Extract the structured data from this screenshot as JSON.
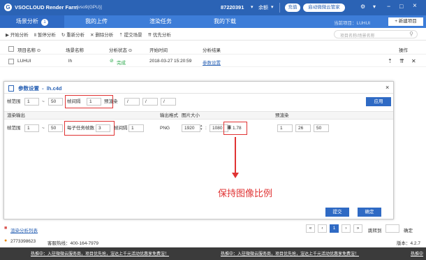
{
  "titlebar": {
    "app_title": "VSOCLOUD Render Farm",
    "version": "[vso9(GPU)]",
    "account_id": "87220391",
    "balance_label": "余额",
    "recharge_label": "充值",
    "activate_label": "启动微微云管家",
    "window_controls": [
      "⚙",
      "▾",
      "−",
      "□",
      "×"
    ]
  },
  "nav": {
    "tabs": [
      {
        "label": "场景分析",
        "badge": "1"
      },
      {
        "label": "我的上传"
      },
      {
        "label": "渲染任务"
      },
      {
        "label": "我的下载"
      }
    ],
    "current_project": "当前项目：LUHUI",
    "new_project": "+ 新建项目"
  },
  "toolbar": {
    "buttons": [
      "▶ 开始分析",
      "Ⅱ 暂停分析",
      "↻ 重新分析",
      "✕ 删除分析",
      "⇡ 提交场景",
      "⇈ 优先分析"
    ],
    "search_placeholder": "项目名称/场景名称"
  },
  "table": {
    "headers": [
      "项目名称 ⊙",
      "场景名称",
      "分析状态 ⊙",
      "开始时间",
      "分析结果",
      "操作"
    ],
    "rows": [
      {
        "project": "LUHUI",
        "scene": "lh",
        "status": "完成",
        "time": "2018-03-27 15:20:59",
        "result": "参数设置"
      }
    ]
  },
  "dialog": {
    "title": "参数设置  -  lh.c4d",
    "row1": {
      "frame_range_label": "帧范围",
      "frame_start": "1",
      "frame_to": "~",
      "frame_end": "50",
      "interval_label": "帧间隔",
      "interval": "1",
      "prerender_label": "预渲染",
      "pre1": "/",
      "pre2": "/",
      "pre3": "/",
      "apply": "应用"
    },
    "section_header": {
      "render_output": "渲染输出",
      "output_format": "输出格式",
      "image_size": "图片大小",
      "prerender": "预渲染"
    },
    "row2": {
      "frame_range_label": "帧范围",
      "frame_start": "1",
      "frame_to": "~",
      "frame_end": "50",
      "frames_per_task_label": "每子任务帧数",
      "frames_per_task": "3",
      "interval_label": "帧间隔",
      "interval": "1",
      "format": "PNG",
      "width": "1920",
      "x": ":",
      "height": "1080",
      "ratio": "1.78",
      "pre_a": "1",
      "pre_b": "26",
      "pre_c": "50"
    },
    "annotation": "保持图像比例",
    "submit": "提交",
    "confirm": "确定"
  },
  "bottom": {
    "render_list": "渲染分析列表",
    "jump_label": "跳转到",
    "confirm": "确定",
    "page": "1",
    "pager": [
      "«",
      "‹",
      "1",
      "›",
      "»"
    ],
    "qq": "2773398623",
    "hotline": "客服热线：400-164-7979",
    "version": "版本：4.2.7"
  },
  "statusbar": {
    "ticker": "热推中：入驻微微云服务商，项目优先抢，渲达上千元活动优惠享免费渲！",
    "ticker2": "热推中：入驻微微云服务商，项目优先抢，渲达上千元活动优惠享免费渲！",
    "ticker3": "热推中"
  },
  "colors": {
    "primary": "#2b63b5",
    "nav": "#3d7dd8",
    "annotation_red": "#e03333",
    "success": "#2aa84a"
  }
}
